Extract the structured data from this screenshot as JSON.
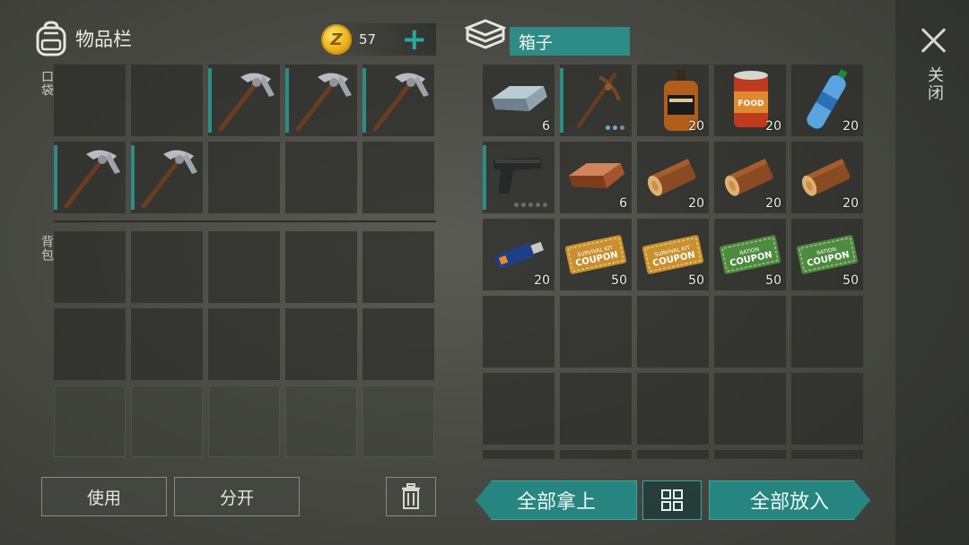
{
  "inventory": {
    "title": "物品栏",
    "pocket_label": "口袋",
    "backpack_label": "背包",
    "coins": "57",
    "coin_symbol": "Z",
    "add_label": "+",
    "pocket_slots": [
      {
        "item": "",
        "count": ""
      },
      {
        "item": "",
        "count": ""
      },
      {
        "item": "pickaxe",
        "count": ""
      },
      {
        "item": "pickaxe",
        "count": ""
      },
      {
        "item": "pickaxe",
        "count": ""
      },
      {
        "item": "pickaxe",
        "count": ""
      },
      {
        "item": "pickaxe",
        "count": ""
      },
      {
        "item": "",
        "count": ""
      },
      {
        "item": "",
        "count": ""
      },
      {
        "item": "",
        "count": ""
      }
    ]
  },
  "buttons": {
    "use": "使用",
    "split": "分开",
    "take_all": "全部拿上",
    "put_all": "全部放入"
  },
  "box": {
    "title": "箱子",
    "slots": [
      {
        "item": "iron-bar",
        "count": "6"
      },
      {
        "item": "crossbow-pickaxe",
        "count": ""
      },
      {
        "item": "whiskey-bottle",
        "count": "20"
      },
      {
        "item": "canned-food",
        "count": "20"
      },
      {
        "item": "water-bottle",
        "count": "20"
      },
      {
        "item": "pistol",
        "count": ""
      },
      {
        "item": "copper-bar",
        "count": "6"
      },
      {
        "item": "wood-log",
        "count": "20"
      },
      {
        "item": "wood-log",
        "count": "20"
      },
      {
        "item": "wood-log",
        "count": "20"
      },
      {
        "item": "usb-drive",
        "count": "20"
      },
      {
        "item": "survival-coupon",
        "count": "50"
      },
      {
        "item": "survival-coupon",
        "count": "50"
      },
      {
        "item": "ration-coupon",
        "count": "50"
      },
      {
        "item": "ration-coupon",
        "count": "50"
      }
    ],
    "coupon_texts": {
      "survival_small": "SURVIVAL KIT",
      "survival_big": "COUPON",
      "ration_small": "RATION",
      "ration_big": "COUPON"
    },
    "food_label": "FOOD"
  },
  "close": {
    "label": "关闭"
  },
  "colors": {
    "accent": "#27857f",
    "slot_bg": "#2c2d29",
    "coin": "#e8b21a"
  }
}
